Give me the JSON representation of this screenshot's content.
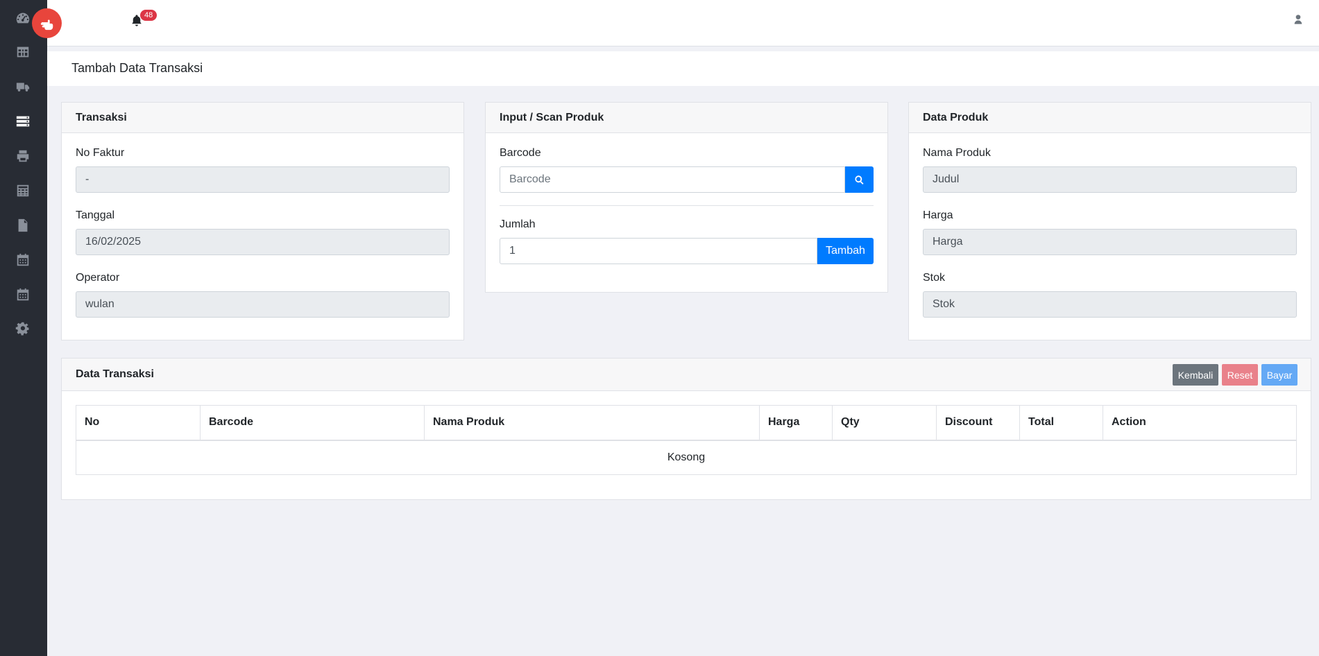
{
  "notifications": {
    "count": "48"
  },
  "page": {
    "title": "Tambah Data Transaksi"
  },
  "transaksi": {
    "header": "Transaksi",
    "no_faktur_label": "No Faktur",
    "no_faktur_value": "-",
    "tanggal_label": "Tanggal",
    "tanggal_value": "16/02/2025",
    "operator_label": "Operator",
    "operator_value": "wulan"
  },
  "input_scan": {
    "header": "Input / Scan Produk",
    "barcode_label": "Barcode",
    "barcode_placeholder": "Barcode",
    "jumlah_label": "Jumlah",
    "jumlah_value": "1",
    "tambah_label": "Tambah"
  },
  "data_produk": {
    "header": "Data Produk",
    "nama_label": "Nama Produk",
    "nama_value": "Judul",
    "harga_label": "Harga",
    "harga_value": "Harga",
    "stok_label": "Stok",
    "stok_value": "Stok"
  },
  "data_transaksi": {
    "header": "Data Transaksi",
    "buttons": {
      "kembali": "Kembali",
      "reset": "Reset",
      "bayar": "Bayar"
    },
    "columns": [
      "No",
      "Barcode",
      "Nama Produk",
      "Harga",
      "Qty",
      "Discount",
      "Total",
      "Action"
    ],
    "empty_text": "Kosong"
  },
  "colors": {
    "sidebar": "#282c34",
    "brand": "#e8453c",
    "primary": "#007bff",
    "kembali": "#6c757d",
    "reset": "#e9818a",
    "bayar": "#64a9f5"
  },
  "icons": {
    "sidebar": [
      "dashboard-icon",
      "table-icon",
      "truck-icon",
      "server-icon",
      "print-icon",
      "calculator-icon",
      "file-icon",
      "calendar-icon",
      "calendar-alt-icon",
      "gear-icon"
    ]
  }
}
